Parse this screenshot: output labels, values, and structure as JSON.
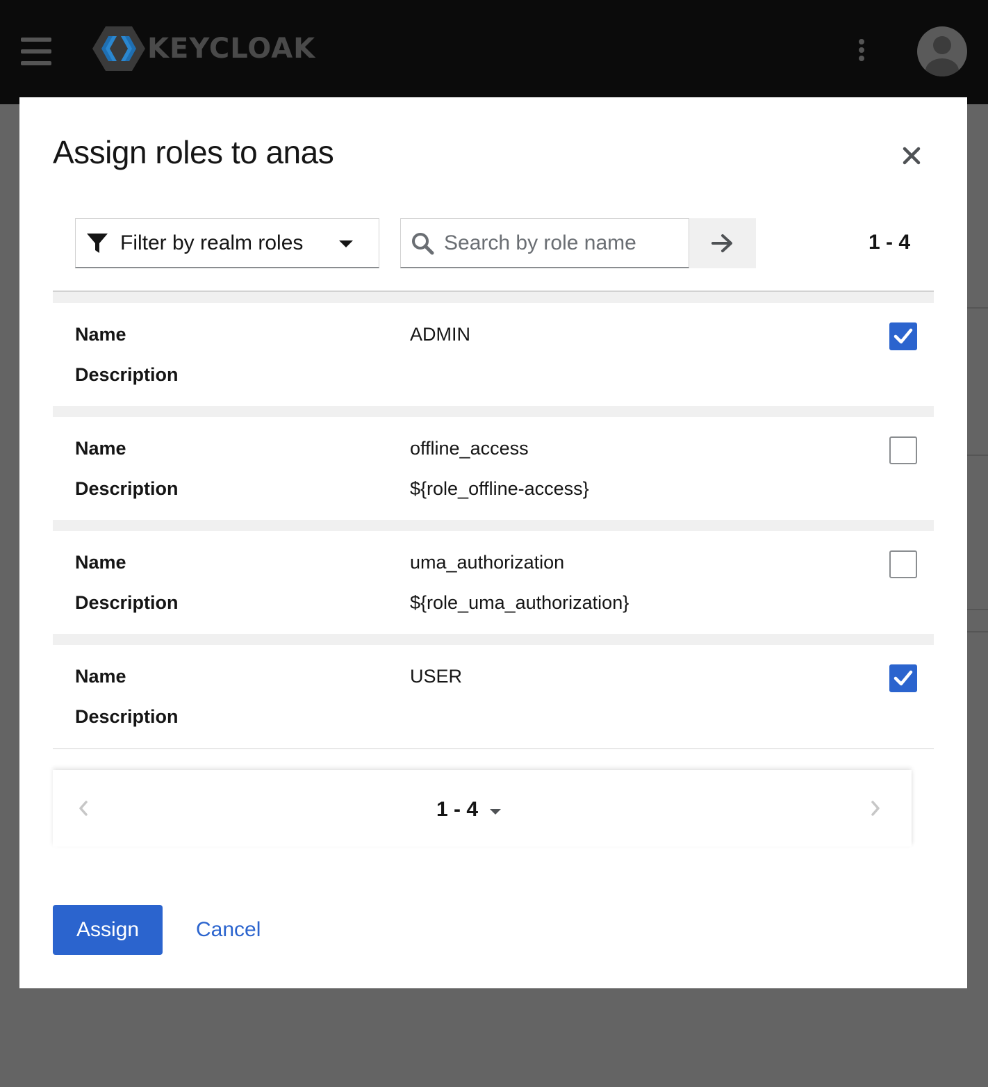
{
  "header": {
    "brand": "KEYCLOAK",
    "menu_icon": "hamburger-menu-icon",
    "kebab_icon": "kebab-icon",
    "avatar_icon": "user-avatar-icon"
  },
  "modal": {
    "title": "Assign roles to anas",
    "close_icon": "close-icon"
  },
  "toolbar": {
    "filter_label": "Filter by realm roles",
    "search_placeholder": "Search by role name",
    "range": "1 - 4"
  },
  "roles": [
    {
      "name_label": "Name",
      "name": "ADMIN",
      "desc_label": "Description",
      "description": "",
      "checked": true
    },
    {
      "name_label": "Name",
      "name": "offline_access",
      "desc_label": "Description",
      "description": "${role_offline-access}",
      "checked": false
    },
    {
      "name_label": "Name",
      "name": "uma_authorization",
      "desc_label": "Description",
      "description": "${role_uma_authorization}",
      "checked": false
    },
    {
      "name_label": "Name",
      "name": "USER",
      "desc_label": "Description",
      "description": "",
      "checked": true
    }
  ],
  "pagination": {
    "range": "1 - 4"
  },
  "footer": {
    "assign_label": "Assign",
    "cancel_label": "Cancel"
  },
  "colors": {
    "primary": "#2b64ce",
    "masthead": "#0b0b0b",
    "backdrop": "#646464"
  }
}
